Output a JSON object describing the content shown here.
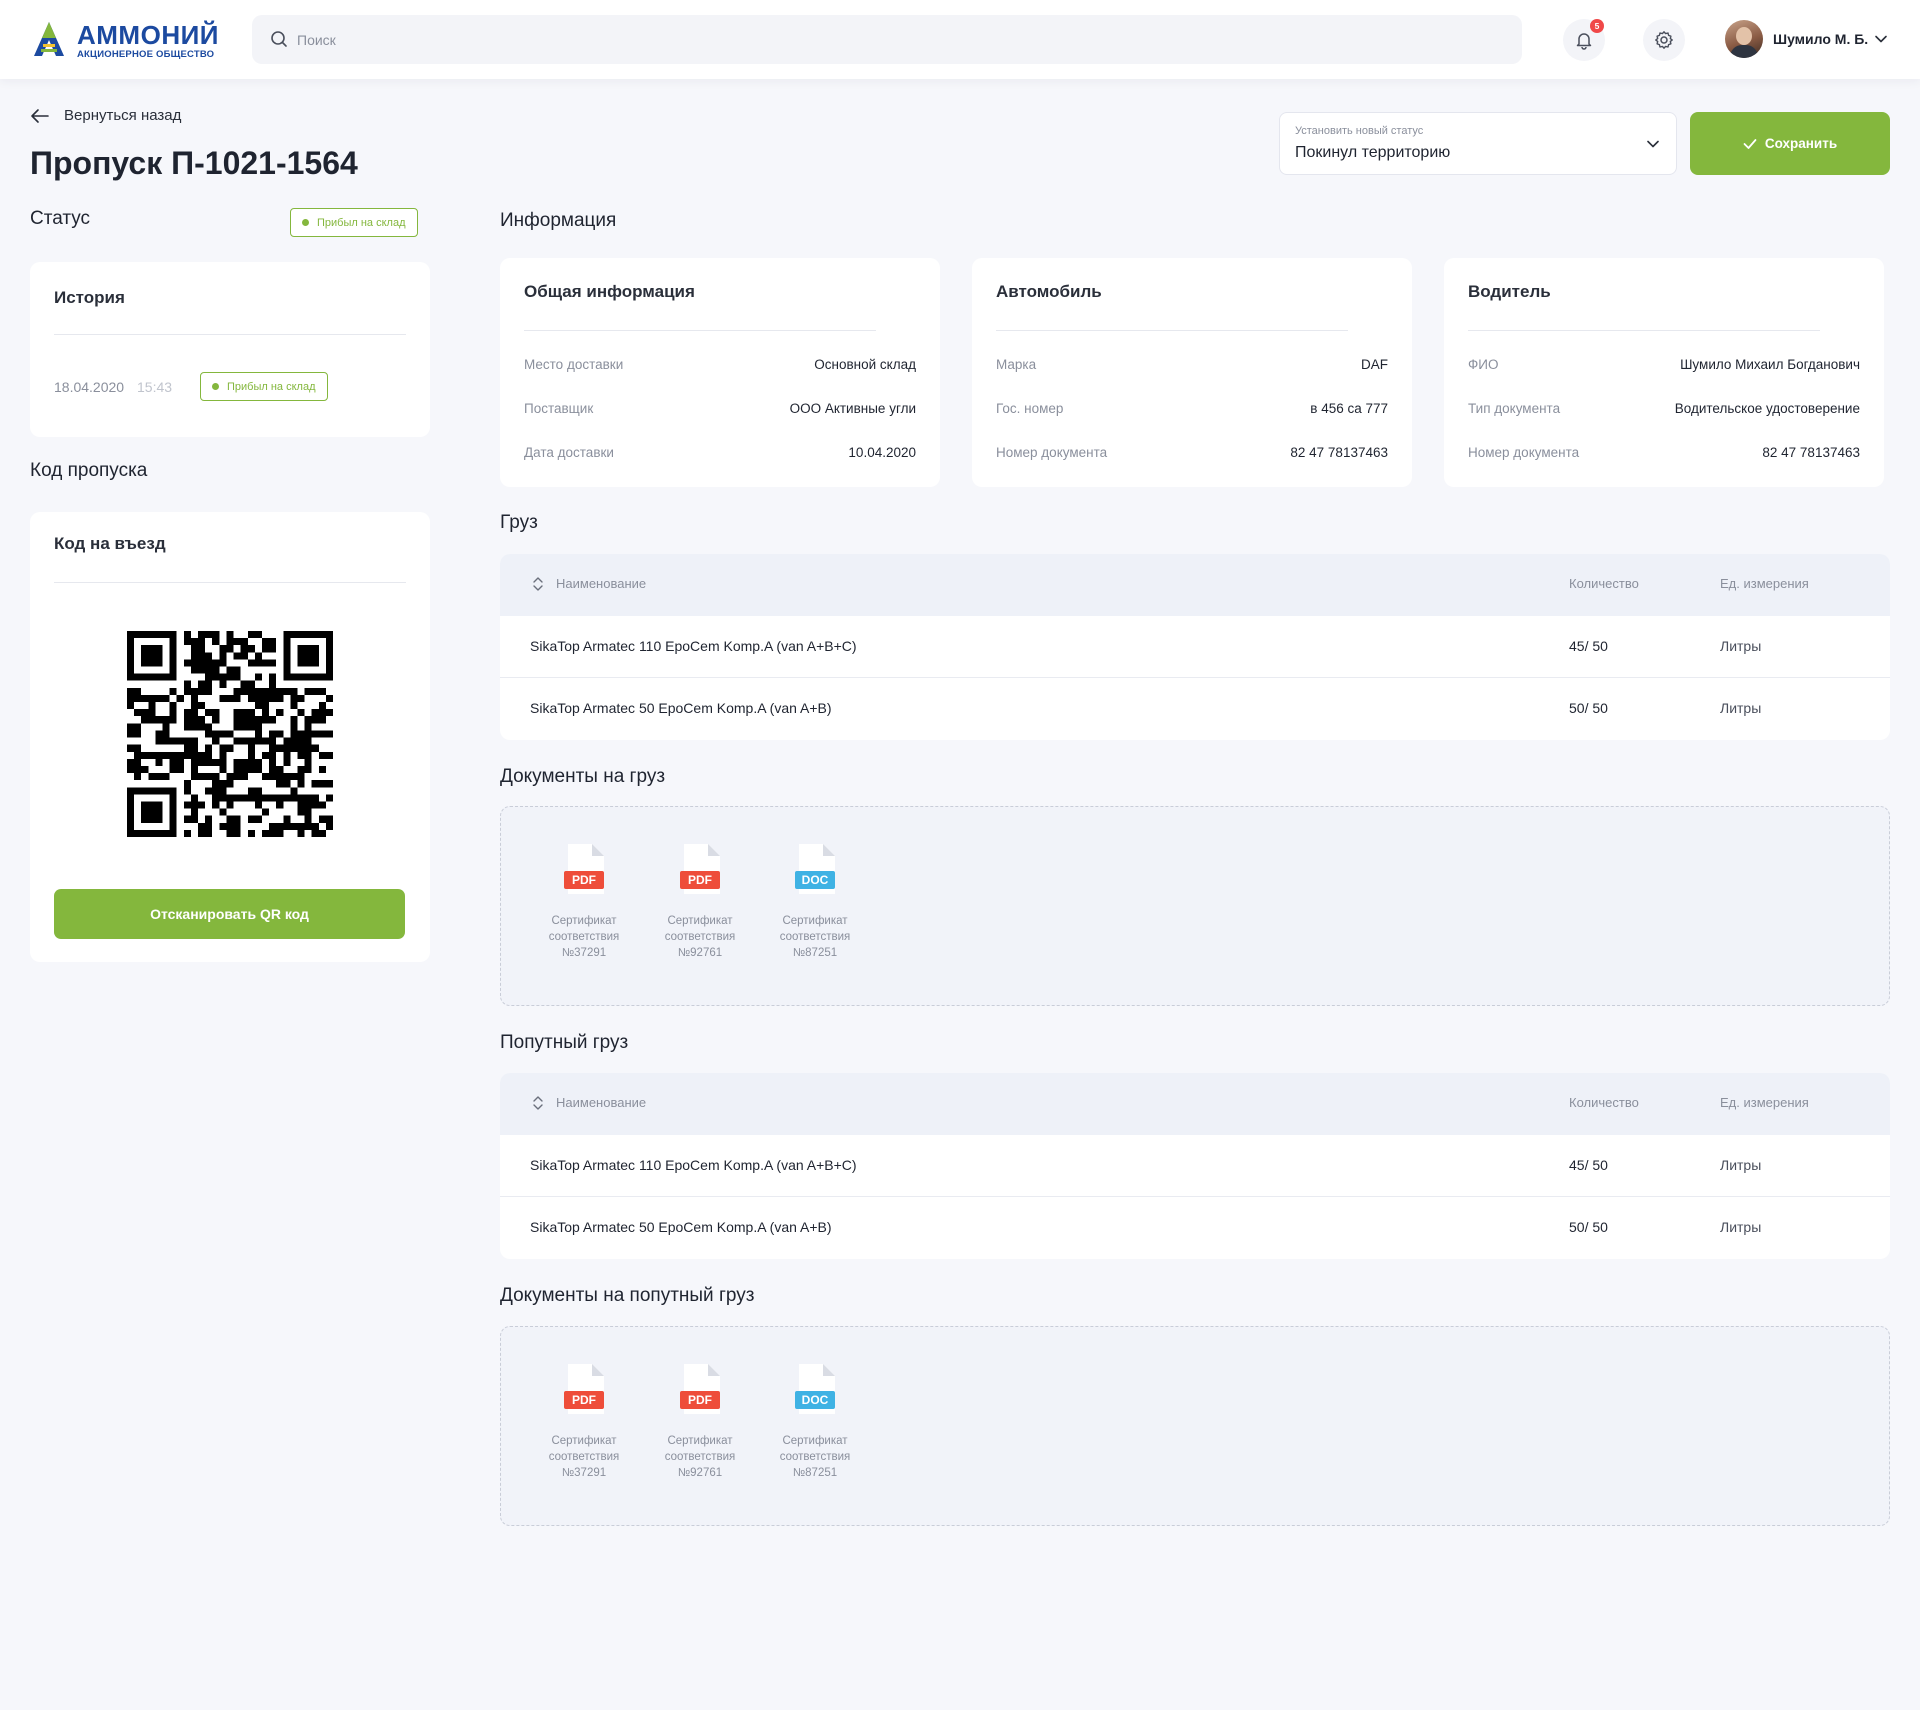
{
  "header": {
    "logo_title": "АММОНИЙ",
    "logo_subtitle": "АКЦИОНЕРНОЕ ОБЩЕСТВО",
    "search_placeholder": "Поиск",
    "notification_count": "5",
    "user_name": "Шумило М. Б."
  },
  "page": {
    "back_label": "Вернуться назад",
    "title": "Пропуск П-1021-1564",
    "status_select_label": "Установить новый статус",
    "status_select_value": "Покинул территорию",
    "save_label": "Сохранить"
  },
  "status": {
    "heading": "Статус",
    "badge": "Прибыл на склад",
    "history_title": "История",
    "history": [
      {
        "date": "18.04.2020",
        "time": "15:43",
        "status": "Прибыл на склад"
      }
    ]
  },
  "pass_code": {
    "heading": "Код пропуска",
    "card_title": "Код на въезд",
    "scan_label": "Отсканировать QR код"
  },
  "info": {
    "heading": "Информация",
    "general": {
      "title": "Общая информация",
      "rows": [
        {
          "k": "Место доставки",
          "v": "Основной склад"
        },
        {
          "k": "Поставщик",
          "v": "ООО Активные угли"
        },
        {
          "k": "Дата доставки",
          "v": "10.04.2020"
        }
      ]
    },
    "vehicle": {
      "title": "Автомобиль",
      "rows": [
        {
          "k": "Марка",
          "v": "DAF"
        },
        {
          "k": "Гос. номер",
          "v": "в 456 са 777"
        },
        {
          "k": "Номер документа",
          "v": "82 47 78137463"
        }
      ]
    },
    "driver": {
      "title": "Водитель",
      "rows": [
        {
          "k": "ФИО",
          "v": "Шумило Михаил Богданович"
        },
        {
          "k": "Тип документа",
          "v": "Водительское удостоверение"
        },
        {
          "k": "Номер документа",
          "v": "82 47 78137463"
        }
      ]
    }
  },
  "cargo": {
    "heading": "Груз",
    "columns": [
      "Наименование",
      "Количество",
      "Ед. измерения"
    ],
    "rows": [
      {
        "name": "SikaTop Armatec 110 EpoCem Komp.A (van A+B+C)",
        "qty": "45/ 50",
        "unit": "Литры"
      },
      {
        "name": "SikaTop Armatec 50 EpoCem Komp.A (van A+B)",
        "qty": "50/ 50",
        "unit": "Литры"
      }
    ]
  },
  "cargo_docs": {
    "heading": "Документы на груз",
    "files": [
      {
        "type": "PDF",
        "caption_1": "Сертификат",
        "caption_2": "соответствия",
        "caption_3": "№37291",
        "color": "#ee4d3a"
      },
      {
        "type": "PDF",
        "caption_1": "Сертификат",
        "caption_2": "соответствия",
        "caption_3": "№92761",
        "color": "#ee4d3a"
      },
      {
        "type": "DOC",
        "caption_1": "Сертификат",
        "caption_2": "соответствия",
        "caption_3": "№87251",
        "color": "#3fb2e4"
      }
    ]
  },
  "extra_cargo": {
    "heading": "Попутный груз",
    "columns": [
      "Наименование",
      "Количество",
      "Ед. измерения"
    ],
    "rows": [
      {
        "name": "SikaTop Armatec 110 EpoCem Komp.A (van A+B+C)",
        "qty": "45/ 50",
        "unit": "Литры"
      },
      {
        "name": "SikaTop Armatec 50 EpoCem Komp.A (van A+B)",
        "qty": "50/ 50",
        "unit": "Литры"
      }
    ]
  },
  "extra_cargo_docs": {
    "heading": "Документы на попутный груз",
    "files": [
      {
        "type": "PDF",
        "caption_1": "Сертификат",
        "caption_2": "соответствия",
        "caption_3": "№37291",
        "color": "#ee4d3a"
      },
      {
        "type": "PDF",
        "caption_1": "Сертификат",
        "caption_2": "соответствия",
        "caption_3": "№92761",
        "color": "#ee4d3a"
      },
      {
        "type": "DOC",
        "caption_1": "Сертификат",
        "caption_2": "соответствия",
        "caption_3": "№87251",
        "color": "#3fb2e4"
      }
    ]
  },
  "colors": {
    "accent_green": "#84b73d",
    "brand_blue": "#1c4aa0",
    "page_bg": "#f6f7fb",
    "notification_red": "#f04848"
  }
}
